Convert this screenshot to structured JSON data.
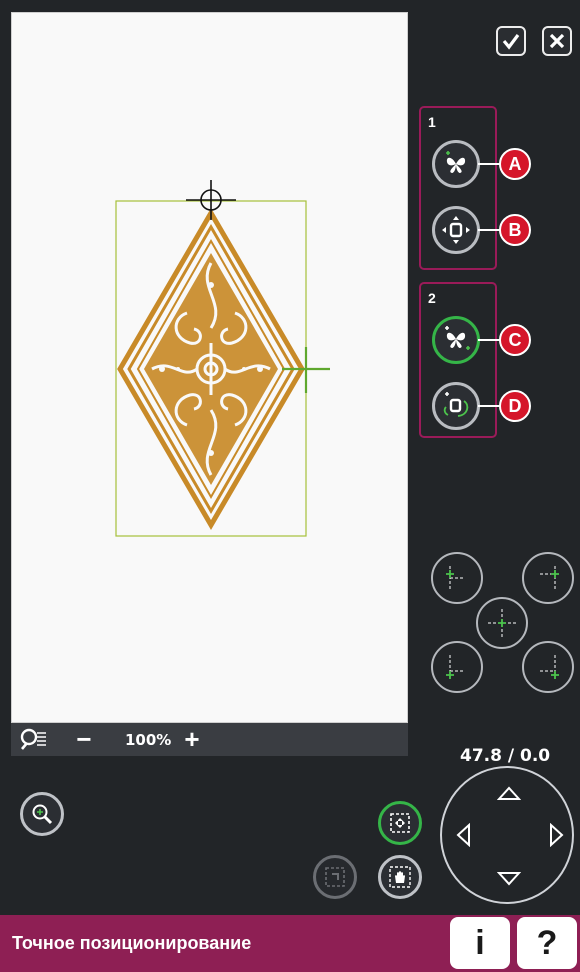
{
  "zoom": {
    "value": "100%",
    "minus": "−",
    "plus": "+"
  },
  "groups": [
    {
      "number": "1",
      "buttons": [
        {
          "callout": "A"
        },
        {
          "callout": "B"
        }
      ]
    },
    {
      "number": "2",
      "buttons": [
        {
          "callout": "C"
        },
        {
          "callout": "D"
        }
      ]
    }
  ],
  "coordinates": "47.8 / 0.0",
  "status_title": "Точное позиционирование",
  "info_label": "i",
  "help_label": "?",
  "colors": {
    "accent": "#8e1f54",
    "callout": "#d5162a",
    "active_green": "#35b548",
    "design_gold": "#c88a28",
    "frame_green": "#a6c03a"
  },
  "icons": {
    "confirm": "check-icon",
    "close": "close-icon",
    "zoom": "zoom-options-icon",
    "zoom_in": "magnifier-icon",
    "move": "move-frame-icon",
    "pan": "hand-icon",
    "center": "center-position-icon"
  }
}
